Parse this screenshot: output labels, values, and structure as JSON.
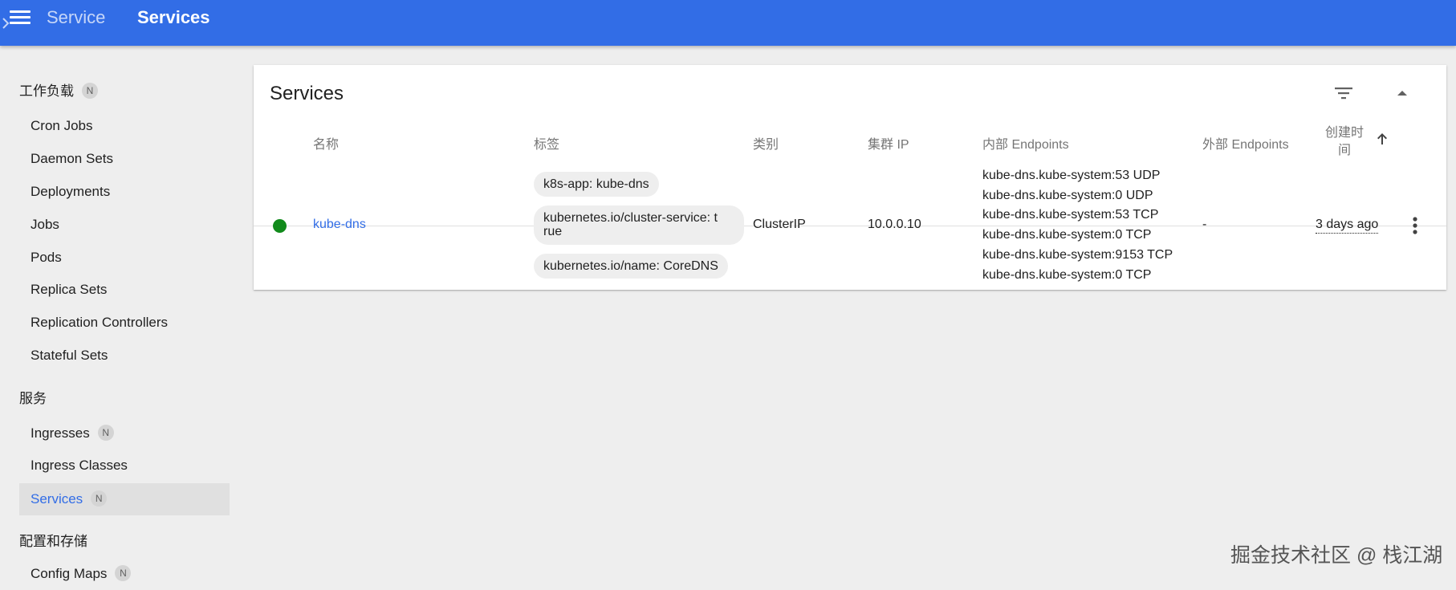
{
  "topbar": {
    "menu_icon": "menu-icon",
    "breadcrumb_parent": "Service",
    "breadcrumb_separator_icon": "chevron-right-icon",
    "breadcrumb_current": "Services",
    "color": "#326de6"
  },
  "sidebar": {
    "sections": [
      {
        "label": "工作负载",
        "badge": "N"
      },
      {
        "label": "服务"
      },
      {
        "label": "配置和存储"
      }
    ],
    "workloads": [
      {
        "label": "Cron Jobs"
      },
      {
        "label": "Daemon Sets"
      },
      {
        "label": "Deployments"
      },
      {
        "label": "Jobs"
      },
      {
        "label": "Pods"
      },
      {
        "label": "Replica Sets"
      },
      {
        "label": "Replication Controllers"
      },
      {
        "label": "Stateful Sets"
      }
    ],
    "service_items": [
      {
        "label": "Ingresses",
        "badge": "N"
      },
      {
        "label": "Ingress Classes"
      },
      {
        "label": "Services",
        "badge": "N",
        "active": true
      }
    ],
    "config_items": [
      {
        "label": "Config Maps",
        "badge": "N"
      }
    ]
  },
  "card": {
    "title": "Services",
    "filter_icon": "filter-icon",
    "collapse_icon": "arrow-up-icon",
    "columns": {
      "name": "名称",
      "labels": "标签",
      "type": "类别",
      "cluster_ip": "集群 IP",
      "internal_endpoints": "内部 Endpoints",
      "external_endpoints": "外部 Endpoints",
      "created_line1": "创建时",
      "created_line2": "间",
      "sort_icon": "arrow-upward-icon"
    },
    "rows": [
      {
        "status": "running",
        "status_color": "#118a1b",
        "name": "kube-dns",
        "labels": [
          "k8s-app: kube-dns",
          "kubernetes.io/cluster-service: t",
          "rue",
          "kubernetes.io/name: CoreDNS"
        ],
        "type": "ClusterIP",
        "cluster_ip": "10.0.0.10",
        "internal_endpoints": [
          "kube-dns.kube-system:53 UDP",
          "kube-dns.kube-system:0 UDP",
          "kube-dns.kube-system:53 TCP",
          "kube-dns.kube-system:0 TCP",
          "kube-dns.kube-system:9153 TCP",
          "kube-dns.kube-system:0 TCP"
        ],
        "external_endpoints": "-",
        "created": "3 days ago",
        "actions_icon": "more-vert-icon"
      }
    ]
  },
  "watermark": "掘金技术社区 @ 栈江湖"
}
